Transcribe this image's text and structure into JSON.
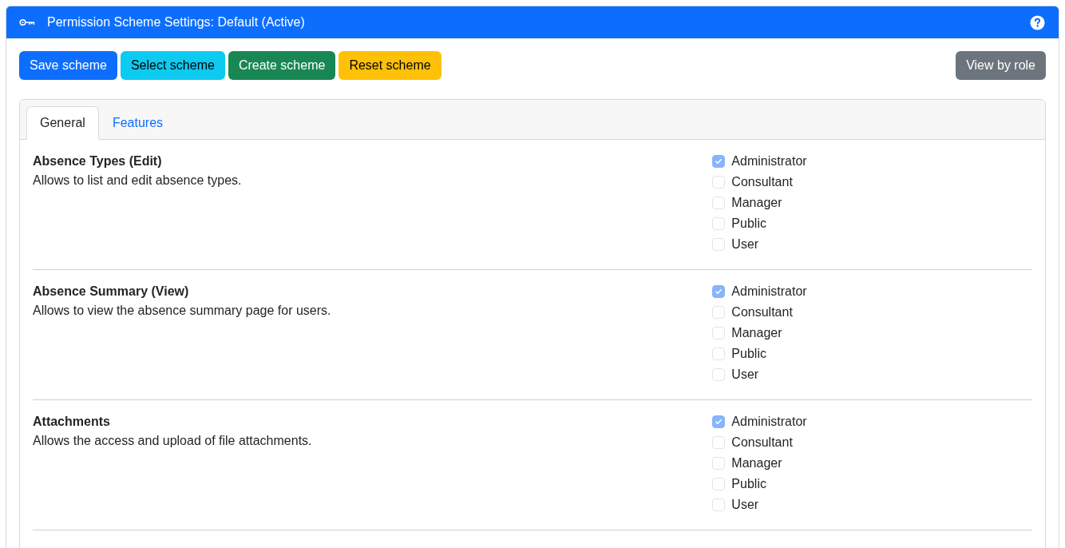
{
  "header": {
    "title": "Permission Scheme Settings: Default (Active)"
  },
  "toolbar": {
    "buttons": [
      {
        "label": "Save scheme",
        "kind": "primary"
      },
      {
        "label": "Select scheme",
        "kind": "info"
      },
      {
        "label": "Create scheme",
        "kind": "success"
      },
      {
        "label": "Reset scheme",
        "kind": "warning"
      }
    ],
    "right_buttons": [
      {
        "label": "View by role",
        "kind": "secondary"
      }
    ]
  },
  "tabs": [
    {
      "label": "General",
      "selected": true
    },
    {
      "label": "Features",
      "selected": false
    }
  ],
  "permissions": [
    {
      "title": "Absence Types (Edit)",
      "description": "Allows to list and edit absence types.",
      "roles": [
        {
          "label": "Administrator",
          "checked": true,
          "disabled": true
        },
        {
          "label": "Consultant",
          "checked": false,
          "disabled": true
        },
        {
          "label": "Manager",
          "checked": false,
          "disabled": true
        },
        {
          "label": "Public",
          "checked": false,
          "disabled": true
        },
        {
          "label": "User",
          "checked": false,
          "disabled": true
        }
      ]
    },
    {
      "title": "Absence Summary (View)",
      "description": "Allows to view the absence summary page for users.",
      "roles": [
        {
          "label": "Administrator",
          "checked": true,
          "disabled": true
        },
        {
          "label": "Consultant",
          "checked": false,
          "disabled": true
        },
        {
          "label": "Manager",
          "checked": false,
          "disabled": true
        },
        {
          "label": "Public",
          "checked": false,
          "disabled": true
        },
        {
          "label": "User",
          "checked": false,
          "disabled": true
        }
      ]
    },
    {
      "title": "Attachments",
      "description": "Allows the access and upload of file attachments.",
      "roles": [
        {
          "label": "Administrator",
          "checked": true,
          "disabled": true
        },
        {
          "label": "Consultant",
          "checked": false,
          "disabled": true
        },
        {
          "label": "Manager",
          "checked": false,
          "disabled": true
        },
        {
          "label": "Public",
          "checked": false,
          "disabled": true
        },
        {
          "label": "User",
          "checked": false,
          "disabled": true
        }
      ]
    }
  ]
}
